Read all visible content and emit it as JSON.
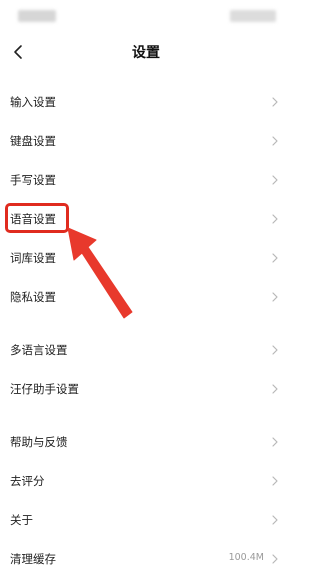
{
  "nav": {
    "title": "设置",
    "back_icon": "chevron-left-icon"
  },
  "menu": {
    "items": [
      {
        "label": "输入设置"
      },
      {
        "label": "键盘设置"
      },
      {
        "label": "手写设置"
      },
      {
        "label": "语音设置",
        "highlighted": true
      },
      {
        "label": "词库设置"
      },
      {
        "label": "隐私设置"
      },
      {
        "label": "多语言设置"
      },
      {
        "label": "汪仔助手设置"
      },
      {
        "label": "帮助与反馈"
      },
      {
        "label": "去评分"
      },
      {
        "label": "关于"
      },
      {
        "label": "清理缓存",
        "value": "100.4M"
      }
    ]
  },
  "colors": {
    "highlight": "#e02b1f",
    "text": "#222222",
    "chevron": "#b8b8b8",
    "value_text": "#9a9a9a"
  }
}
